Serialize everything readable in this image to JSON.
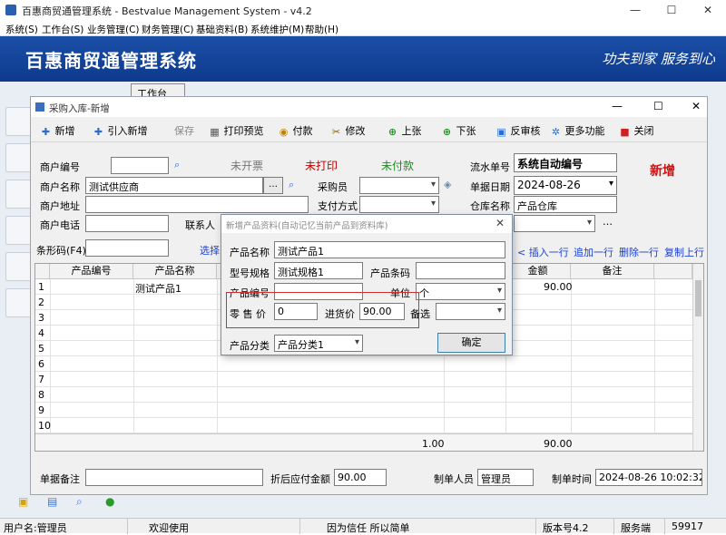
{
  "app": {
    "title": "百惠商贸通管理系统 - Bestvalue Management System - v4.2",
    "banner_title": "百惠商贸通管理系统",
    "banner_slogan": "功夫到家 服务到心"
  },
  "menu": [
    "系统(S)",
    "工作台(S)",
    "业务管理(C)",
    "财务管理(C)",
    "基础资料(B)",
    "系统维护(M)",
    "帮助(H)"
  ],
  "workbench_tab": "工作台",
  "window": {
    "title": "采购入库-新增",
    "toolbar": {
      "add": "新增",
      "import": "引入新增",
      "save": "保存",
      "print_preview": "打印预览",
      "pay": "付款",
      "edit": "修改",
      "prev": "上张",
      "next": "下张",
      "unreview": "反审核",
      "more": "更多功能",
      "close": "关闭"
    },
    "form": {
      "merchant_code_label": "商户编号",
      "merchant_code": "",
      "merchant_name_label": "商户名称",
      "merchant_name": "测试供应商",
      "merchant_addr_label": "商户地址",
      "merchant_addr": "",
      "merchant_phone_label": "商户电话",
      "merchant_phone": "",
      "contact_label": "联系人",
      "buyer_label": "采购员",
      "buyer": "",
      "payment_label": "支付方式",
      "payment": "",
      "status_invoice": "未开票",
      "status_print": "未打印",
      "status_paid": "未付款",
      "doc_no_label": "流水单号",
      "doc_no": "系统自动编号",
      "date_label": "单据日期",
      "date": "2024-08-26",
      "warehouse_label": "仓库名称",
      "warehouse": "产品仓库",
      "mode": "新增",
      "barcode_label": "条形码(F4)",
      "select_label": "选择",
      "row_actions": [
        "< 插入一行",
        "追加一行",
        "删除一行",
        "复制上行"
      ]
    },
    "grid": {
      "headers": [
        "产品编号",
        "产品名称",
        "金额",
        "备注"
      ],
      "rows": [
        {
          "no": "1",
          "name": "测试产品1",
          "amount": "90.00"
        },
        {
          "no": "2"
        },
        {
          "no": "3"
        },
        {
          "no": "4"
        },
        {
          "no": "5"
        },
        {
          "no": "6"
        },
        {
          "no": "7"
        },
        {
          "no": "8"
        },
        {
          "no": "9"
        },
        {
          "no": "10"
        }
      ],
      "total_qty": "1.00",
      "total_amount": "90.00"
    },
    "footer": {
      "remark_label": "单据备注",
      "remark": "",
      "payable_label": "折后应付金额",
      "payable": "90.00",
      "maker_label": "制单人员",
      "maker": "管理员",
      "make_time_label": "制单时间",
      "make_time": "2024-08-26 10:02:32"
    }
  },
  "dialog": {
    "title": "新增产品资料(自动记忆当前产品到资料库)",
    "name_label": "产品名称",
    "name": "测试产品1",
    "spec_label": "型号规格",
    "spec": "测试规格1",
    "barcode_label": "产品条码",
    "barcode": "",
    "code_label": "产品编号",
    "code": "",
    "unit_label": "单位",
    "unit": "个",
    "retail_label": "零 售 价",
    "retail": "0",
    "purchase_label": "进货价",
    "purchase": "90.00",
    "remark_label": "备选",
    "remark": "",
    "category_label": "产品分类",
    "category": "产品分类1",
    "ok": "确定"
  },
  "statusbar": {
    "user": "用户名:管理员",
    "welcome": "欢迎使用",
    "motto": "因为信任 所以简单",
    "version": "版本号4.2",
    "service": "服务端",
    "code": "59917"
  },
  "colors": {
    "banner": "#1c4fa8",
    "status_red": "#c00000",
    "status_green": "#1f8a1f",
    "link_blue": "#1a3fd0"
  }
}
